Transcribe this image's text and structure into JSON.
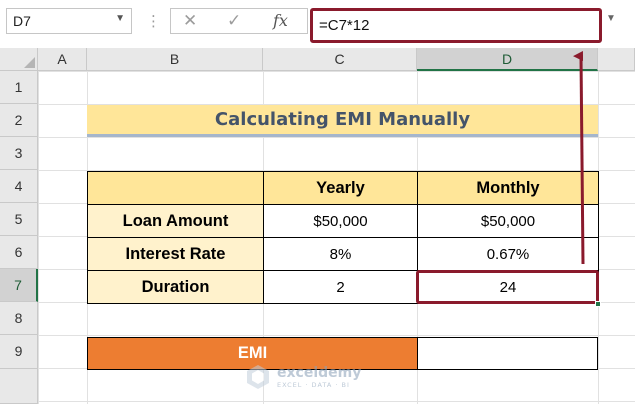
{
  "formula_bar": {
    "name_box": "D7",
    "formula": "=C7*12",
    "fx_label": "fx",
    "cancel_icon": "close-icon",
    "enter_icon": "check-icon"
  },
  "columns": [
    "A",
    "B",
    "C",
    "D"
  ],
  "selected_column": "D",
  "rows": [
    "1",
    "2",
    "3",
    "4",
    "5",
    "6",
    "7",
    "8",
    "9"
  ],
  "selected_row": "7",
  "sheet": {
    "title": "Calculating EMI Manually",
    "table": {
      "headers": [
        "",
        "Yearly",
        "Monthly"
      ],
      "rows": [
        {
          "label": "Loan Amount",
          "yearly": "$50,000",
          "monthly": "$50,000"
        },
        {
          "label": "Interest Rate",
          "yearly": "8%",
          "monthly": "0.67%"
        },
        {
          "label": "Duration",
          "yearly": "2",
          "monthly": "24"
        }
      ]
    },
    "emi_label": "EMI",
    "emi_value": ""
  },
  "watermark": {
    "name": "exceldemy",
    "tagline": "EXCEL · DATA · BI"
  },
  "colors": {
    "highlight": "#8a1a2c",
    "title_fill": "#ffe699",
    "header_fill": "#ffe699",
    "label_fill": "#fff2cc",
    "emi_fill": "#ed7d31",
    "title_text": "#44546a",
    "excel_green": "#217346"
  }
}
